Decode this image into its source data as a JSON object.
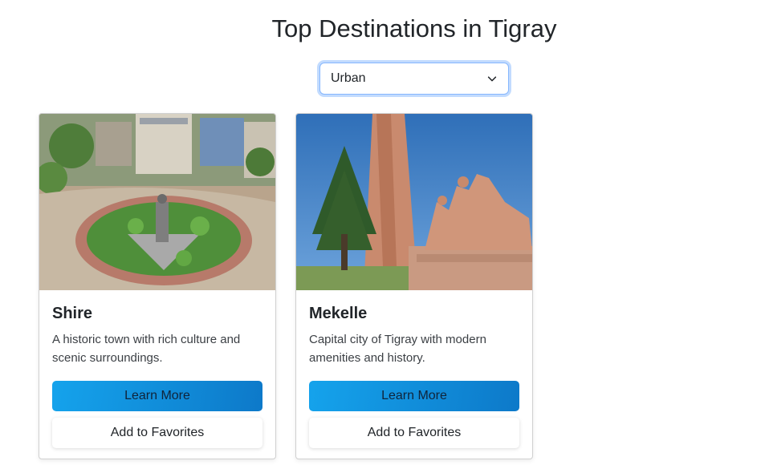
{
  "page": {
    "title": "Top Destinations in Tigray"
  },
  "filter": {
    "selected": "Urban",
    "icon": "chevron-down-icon"
  },
  "cards": [
    {
      "name": "Shire",
      "description": "A historic town with rich culture and scenic surroundings.",
      "primary_label": "Learn More",
      "secondary_label": "Add to Favorites"
    },
    {
      "name": "Mekelle",
      "description": "Capital city of Tigray with modern amenities and history.",
      "primary_label": "Learn More",
      "secondary_label": "Add to Favorites"
    }
  ],
  "colors": {
    "primary_button": "#0d8fdc",
    "focus_ring": "#86b7fe"
  }
}
